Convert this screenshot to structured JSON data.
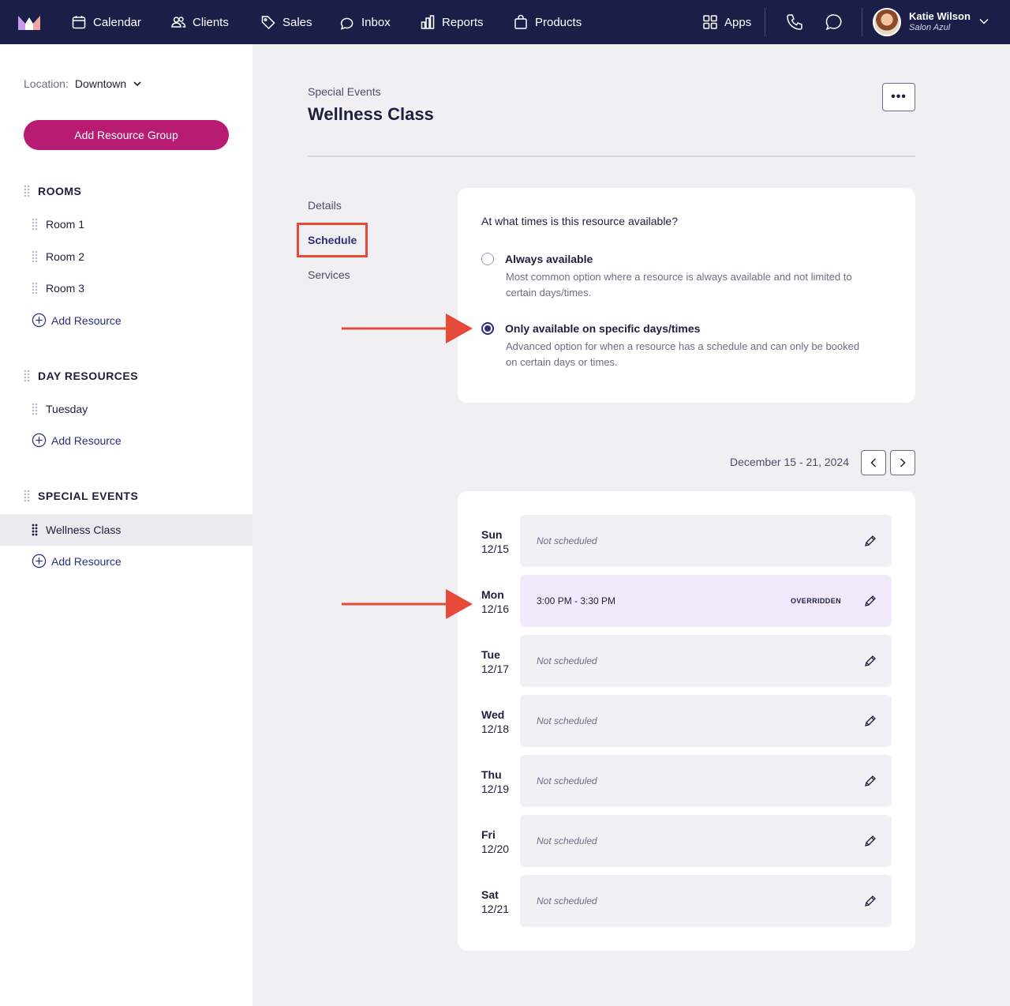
{
  "nav": {
    "items": [
      {
        "label": "Calendar",
        "icon": "calendar-icon"
      },
      {
        "label": "Clients",
        "icon": "clients-icon"
      },
      {
        "label": "Sales",
        "icon": "tag-icon"
      },
      {
        "label": "Inbox",
        "icon": "inbox-icon"
      },
      {
        "label": "Reports",
        "icon": "chart-icon"
      },
      {
        "label": "Products",
        "icon": "bag-icon"
      }
    ],
    "apps_label": "Apps",
    "user": {
      "name": "Katie Wilson",
      "subtitle": "Salon Azul"
    }
  },
  "sidebar": {
    "location_label": "Location:",
    "location_value": "Downtown",
    "add_group_label": "Add Resource Group",
    "add_resource_label": "Add Resource",
    "sections": [
      {
        "title": "ROOMS",
        "items": [
          "Room 1",
          "Room 2",
          "Room 3"
        ]
      },
      {
        "title": "DAY RESOURCES",
        "items": [
          "Tuesday"
        ]
      },
      {
        "title": "SPECIAL EVENTS",
        "items": [
          "Wellness Class"
        ]
      }
    ]
  },
  "main": {
    "breadcrumb": "Special Events",
    "title": "Wellness Class",
    "more_label": "•••",
    "tabs": [
      "Details",
      "Schedule",
      "Services"
    ],
    "active_tab": "Schedule",
    "availability": {
      "question": "At what times is this resource available?",
      "options": [
        {
          "title": "Always available",
          "desc": "Most common option where a resource is always available and not limited to certain days/times.",
          "checked": false
        },
        {
          "title": "Only available on specific days/times",
          "desc": "Advanced option for when a resource has a schedule and can only be booked on certain days or times.",
          "checked": true
        }
      ]
    },
    "date_range": "December 15 - 21, 2024",
    "days": [
      {
        "day": "Sun",
        "date": "12/15",
        "text": "Not scheduled",
        "badge": ""
      },
      {
        "day": "Mon",
        "date": "12/16",
        "text": "3:00 PM - 3:30 PM",
        "badge": "OVERRIDDEN"
      },
      {
        "day": "Tue",
        "date": "12/17",
        "text": "Not scheduled",
        "badge": ""
      },
      {
        "day": "Wed",
        "date": "12/18",
        "text": "Not scheduled",
        "badge": ""
      },
      {
        "day": "Thu",
        "date": "12/19",
        "text": "Not scheduled",
        "badge": ""
      },
      {
        "day": "Fri",
        "date": "12/20",
        "text": "Not scheduled",
        "badge": ""
      },
      {
        "day": "Sat",
        "date": "12/21",
        "text": "Not scheduled",
        "badge": ""
      }
    ]
  },
  "colors": {
    "nav_bg": "#1b1f47",
    "primary_button": "#b71c72",
    "accent": "#2a2f7a",
    "annotation_red": "#e84a3a",
    "overridden_bg": "#f1eafd"
  }
}
